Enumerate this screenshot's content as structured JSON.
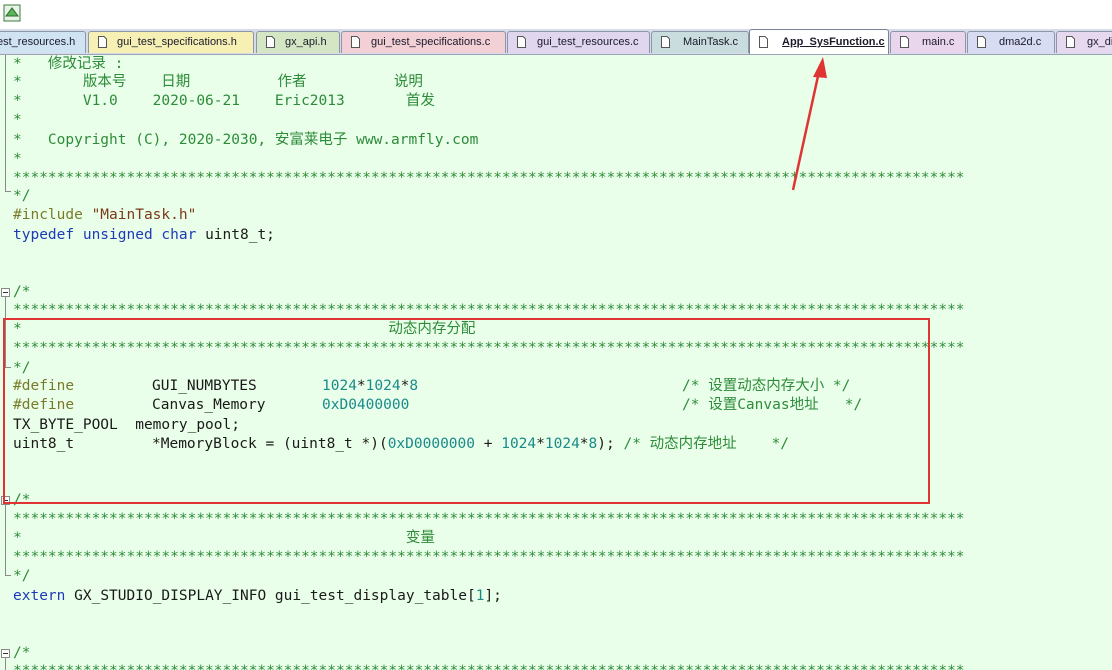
{
  "app": {
    "icon": "app-icon"
  },
  "tabs": [
    {
      "label": "est_resources.h",
      "color": "#cfe3f3",
      "fileicon": "file-icon"
    },
    {
      "label": "gui_test_specifications.h",
      "color": "#f7f0b4",
      "fileicon": "file-icon"
    },
    {
      "label": "gx_api.h",
      "color": "#d4e6c3",
      "fileicon": "file-icon"
    },
    {
      "label": "gui_test_specifications.c",
      "color": "#f3cfd6",
      "fileicon": "file-icon"
    },
    {
      "label": "gui_test_resources.c",
      "color": "#e0d6ee",
      "fileicon": "file-icon"
    },
    {
      "label": "MainTask.c",
      "color": "#c9ddde",
      "fileicon": "file-icon"
    },
    {
      "label": "App_SysFunction.c",
      "color": "#ffffff",
      "fileicon": "file-icon",
      "active": true
    },
    {
      "label": "main.c",
      "color": "#ead6ec",
      "fileicon": "file-icon"
    },
    {
      "label": "dma2d.c",
      "color": "#d7dcf3",
      "fileicon": "file-icon"
    },
    {
      "label": "gx_di",
      "color": "#e6d9ef",
      "fileicon": "file-icon"
    }
  ],
  "code": {
    "l1": "*   修改记录 :",
    "l2": "*       版本号    日期          作者          说明",
    "l3": "*       V1.0    2020-06-21    Eric2013       首发",
    "l4": "*",
    "l5": "*   Copyright (C), 2020-2030, 安富莱电子 www.armfly.com",
    "l6": "*",
    "stars": "*************************************************************************************************************",
    "l8": "*/",
    "inc_kw": "#include",
    "inc_str": "\"MainTask.h\"",
    "td_kw1": "typedef",
    "td_kw2": "unsigned",
    "td_kw3": "char",
    "td_rest": "uint8_t;",
    "open": "/*",
    "sect1": "*                                          动态内存分配",
    "close": "*/",
    "def_kw": "#define",
    "def1_name": "GUI_NUMBYTES",
    "def1_n1": "1024",
    "def1_op1": "*",
    "def1_n2": "1024",
    "def1_op2": "*",
    "def1_n3": "8",
    "def1_cm": "/* 设置动态内存大小 */",
    "def2_name": "Canvas_Memory",
    "def2_val": "0xD0400000",
    "def2_cm": "/* 设置Canvas地址   */",
    "pool_line": "TX_BYTE_POOL  memory_pool;",
    "mb_type": "uint8_t",
    "mb_p1": "*MemoryBlock = (uint8_t *)(",
    "mb_n1": "0xD0000000",
    "mb_p2": " + ",
    "mb_n2": "1024",
    "mb_p3": "*",
    "mb_n3": "1024",
    "mb_p4": "*",
    "mb_n4": "8",
    "mb_p5": ");",
    "mb_cm": "/* 动态内存地址    */",
    "sect2": "*                                            变量",
    "ext_kw": "extern",
    "ext_rest1": "GX_STUDIO_DISPLAY_INFO gui_test_display_table[",
    "ext_num": "1",
    "ext_rest2": "];"
  },
  "annotation": {
    "box_color": "#e03333",
    "arrow_color": "#e03333"
  }
}
